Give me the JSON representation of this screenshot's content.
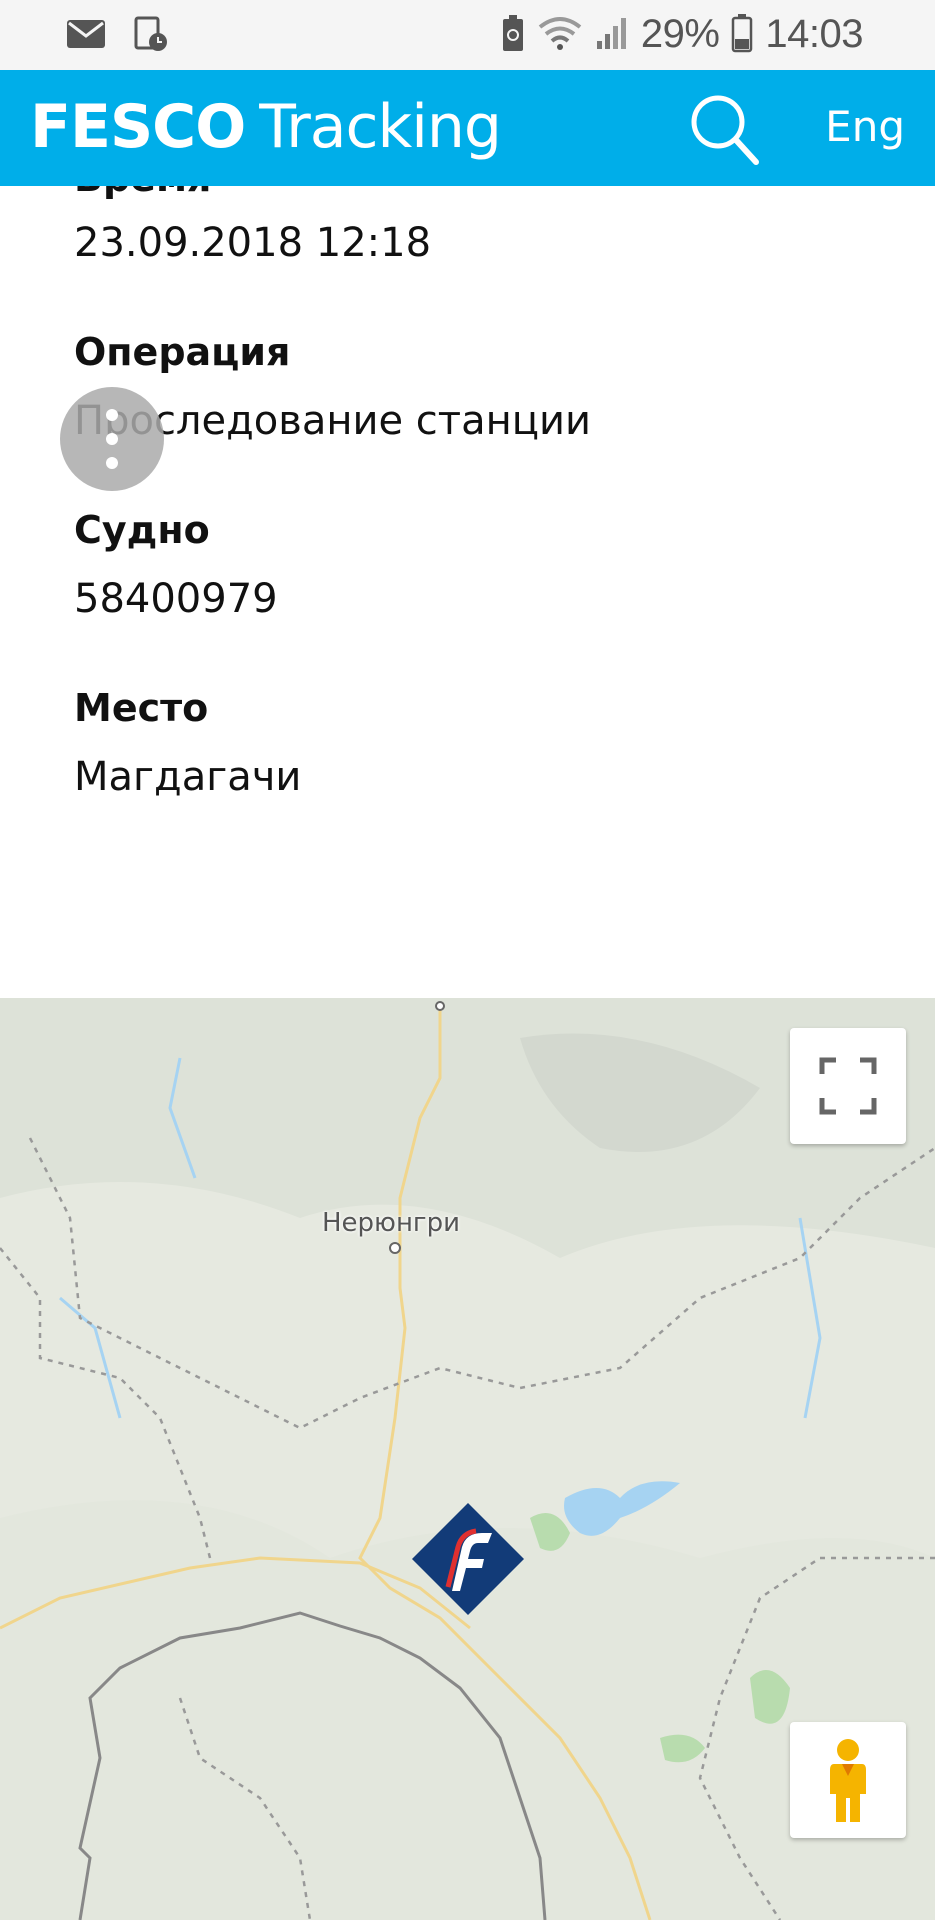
{
  "status_bar": {
    "battery_percent": "29%",
    "time": "14:03",
    "icons": [
      "mail-icon",
      "calendar-clock-icon",
      "battery-saver-icon",
      "wifi-icon",
      "signal-icon",
      "battery-icon"
    ]
  },
  "app_bar": {
    "brand_bold": "FESCO",
    "brand_light": "Tracking",
    "search_icon": "search-icon",
    "language_label": "Eng",
    "color": "#00aee9"
  },
  "details": {
    "time_label": "Время",
    "time_value": "23.09.2018 12:18",
    "operation_label": "Операция",
    "operation_value": "Проследование станции",
    "vessel_label": "Судно",
    "vessel_value": "58400979",
    "place_label": "Место",
    "place_value": "Магдагачи"
  },
  "fab": {
    "icon": "more-vertical-icon"
  },
  "map": {
    "city_label": "Нерюнгри",
    "fullscreen_icon": "fullscreen-icon",
    "pegman_icon": "pegman-icon",
    "marker_icon": "fesco-logo-marker"
  }
}
